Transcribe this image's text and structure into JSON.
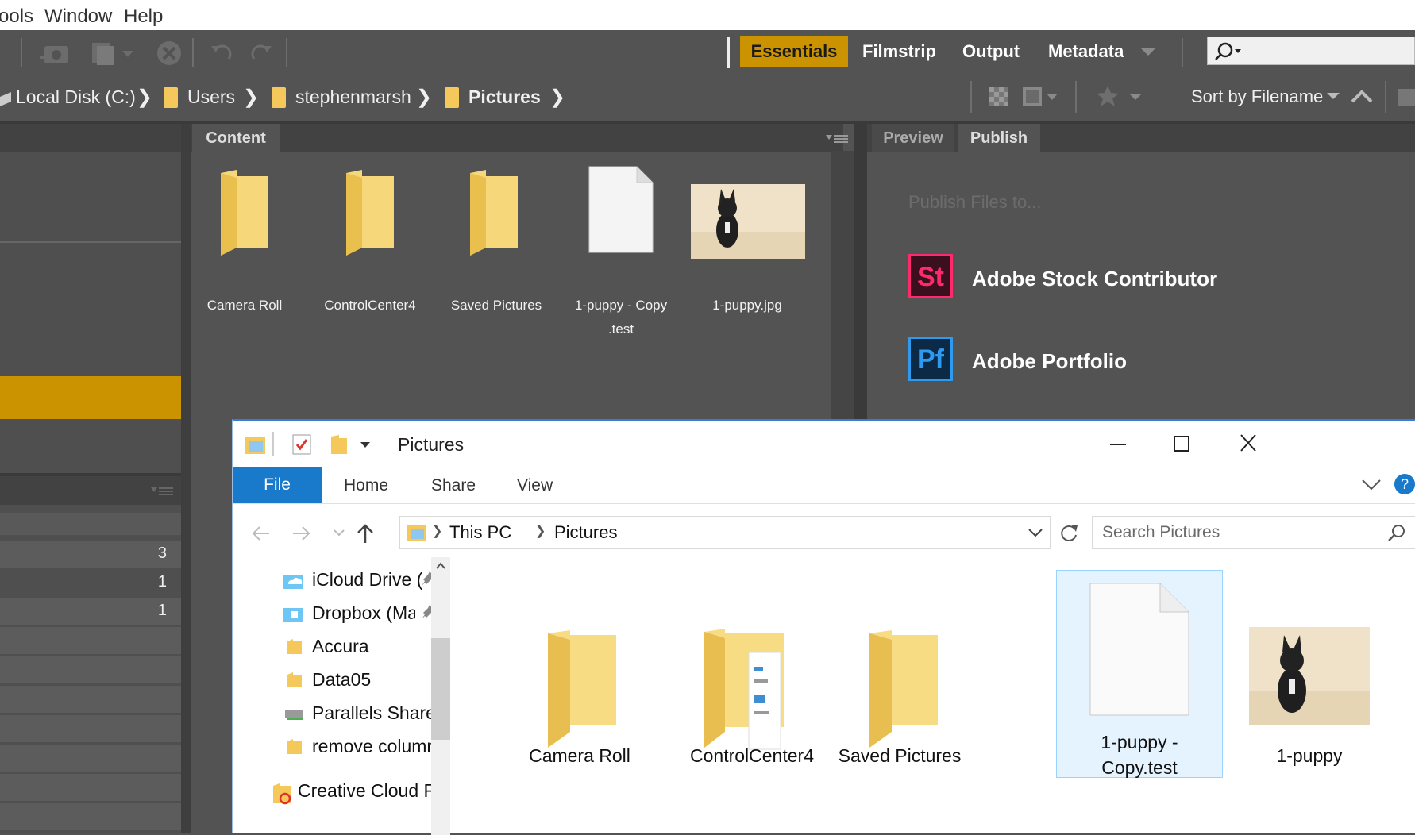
{
  "bridge": {
    "menu": [
      "ools",
      "Window",
      "Help"
    ],
    "workspaces": {
      "active": "Essentials",
      "items": [
        "Filmstrip",
        "Output",
        "Metadata"
      ]
    },
    "path": [
      "Local Disk (C:)",
      "Users",
      "stephenmarsh",
      "Pictures"
    ],
    "sort_label": "Sort by Filename",
    "content_tab": "Content",
    "preview_tab": "Preview",
    "publish_tab": "Publish",
    "thumbnails": [
      {
        "label": "Camera Roll",
        "kind": "folder"
      },
      {
        "label": "ControlCenter4",
        "kind": "folder"
      },
      {
        "label": "Saved Pictures",
        "kind": "folder"
      },
      {
        "label": "1-puppy - Copy .test",
        "line1": "1-puppy - Copy",
        "line2": ".test",
        "kind": "file"
      },
      {
        "label": "1-puppy.jpg",
        "kind": "image"
      }
    ],
    "publish": {
      "heading": "Publish Files to...",
      "services": [
        {
          "badge": "St",
          "name": "Adobe Stock Contributor",
          "color": "#ff2a6d"
        },
        {
          "badge": "Pf",
          "name": "Adobe Portfolio",
          "color": "#2d9af0"
        }
      ]
    },
    "left_counts": [
      "3",
      "1",
      "1"
    ],
    "accent_color": "#cc9300"
  },
  "explorer": {
    "title": "Pictures",
    "ribbon_tabs": {
      "file": "File",
      "items": [
        "Home",
        "Share",
        "View"
      ]
    },
    "address": [
      "This PC",
      "Pictures"
    ],
    "search_placeholder": "Search Pictures",
    "nav_items": [
      "iCloud Drive (",
      "Dropbox (Mac",
      "Accura",
      "Data05",
      "Parallels Share o",
      "remove columns",
      "Creative Cloud File"
    ],
    "items": [
      {
        "label": "Camera Roll",
        "kind": "folder"
      },
      {
        "label": "ControlCenter4",
        "kind": "folder-docs"
      },
      {
        "label": "Saved Pictures",
        "kind": "folder"
      },
      {
        "label": "1-puppy - Copy.test",
        "line1": "1-puppy -",
        "line2": "Copy.test",
        "kind": "file",
        "selected": true
      },
      {
        "label": "1-puppy",
        "kind": "image"
      }
    ],
    "accent_color": "#1979ca"
  }
}
